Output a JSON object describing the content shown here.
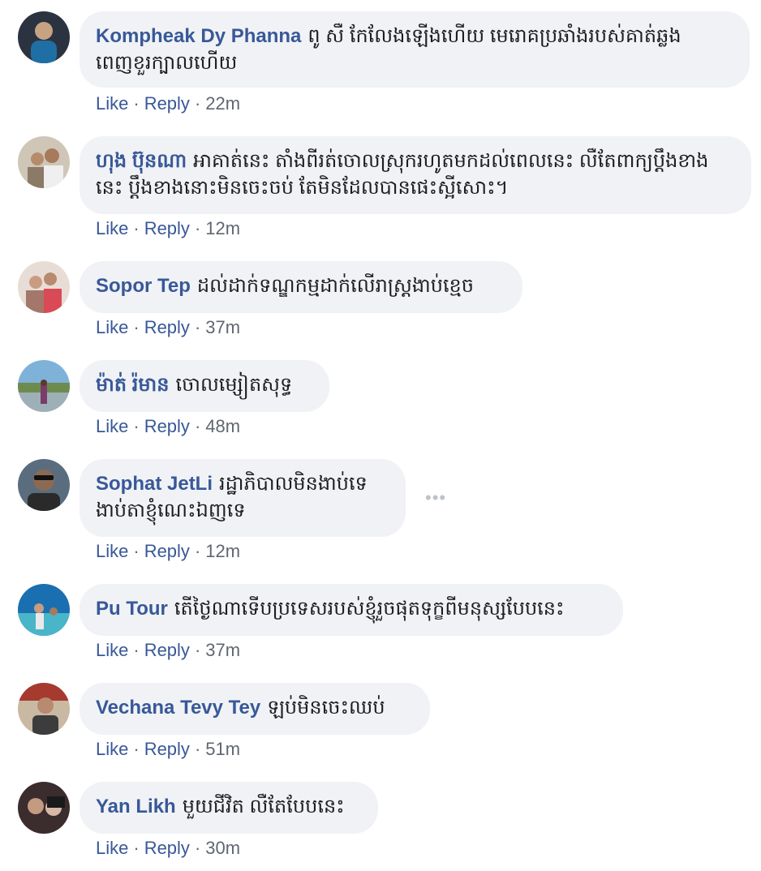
{
  "labels": {
    "like": "Like",
    "reply": "Reply",
    "separator": "·",
    "more": "•••"
  },
  "comments": [
    {
      "author": "Kompheak Dy Phanna",
      "text": "ពូ សឺ កែលែងឡើងហើយ មេរោគប្រឆាំងរបស់គាត់ឆ្លងពេញខួរក្បាលហើយ",
      "time": "22m",
      "avatar_colors": [
        "#2c3340",
        "#1f6fa5"
      ]
    },
    {
      "author": "ហុង ប៊ុនណា",
      "text": "អាគាត់នេះ តាំងពីរត់ចោលស្រុករហូតមកដល់ពេលនេះ លឺតែពាក្យប្តឹងខាងនេះ ប្តឹងខាងនោះមិនចេះចប់ តែមិនដែលបានផេះស្អីសោះ។",
      "time": "12m",
      "avatar_colors": [
        "#8a7a66",
        "#cfa98a"
      ]
    },
    {
      "author": "Sopor Tep",
      "text": "ដល់ដាក់ទណ្ឌកម្មដាក់លើរាស្ត្រងាប់ខ្មេច",
      "time": "37m",
      "avatar_colors": [
        "#a4776b",
        "#e7c4b5"
      ]
    },
    {
      "author": "ម៉ាត់ រ៉មាន",
      "text": "ចោលម្សៀតសុទ្ធ",
      "time": "48m",
      "avatar_colors": [
        "#7fb2d8",
        "#6e8b4f"
      ]
    },
    {
      "author": "Sophat JetLi",
      "text": "រដ្ឋាភិបាលមិនងាប់ទេ ងាប់តាខ្ញុំណេះឯញទេ",
      "time": "12m",
      "avatar_colors": [
        "#5a6d7e",
        "#2a2a2a"
      ]
    },
    {
      "author": "Pu Tour",
      "text": "តើថ្ងៃណាទើបប្រទេសរបស់ខ្ញុំរួចផុតទុក្ខពីមនុស្សបែបនេះ",
      "time": "37m",
      "avatar_colors": [
        "#1a6fb0",
        "#49b5c9"
      ]
    },
    {
      "author": "Vechana Tevy Tey",
      "text": "ឡប់មិនចេះឈប់",
      "time": "51m",
      "avatar_colors": [
        "#c9b9a3",
        "#3c3c3c"
      ]
    },
    {
      "author": "Yan Likh",
      "text": "មួយជីវិត លឺតែបែបនេះ",
      "time": "30m",
      "avatar_colors": [
        "#3b2c2e",
        "#d8b8a6"
      ]
    }
  ]
}
